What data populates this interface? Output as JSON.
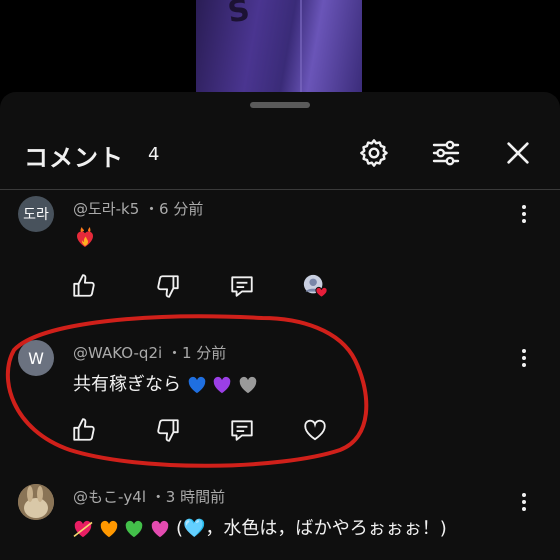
{
  "colors": {
    "sheet_bg": "#0f0f0f",
    "text_primary": "#f1f1f1",
    "text_secondary": "#aaaaaa",
    "annotation_red": "#d0201a",
    "like_heart": "#e61e3a"
  },
  "header": {
    "title": "コメント",
    "count": "4",
    "settings_icon": "gear-icon",
    "filter_icon": "sliders-icon",
    "close_icon": "close-icon"
  },
  "comments": [
    {
      "avatar_text": "도라",
      "avatar_color": "#48525c",
      "author": "@도라-k5",
      "time": "・6 分前",
      "text": "❤️‍🔥",
      "creator_heart": true
    },
    {
      "avatar_text": "W",
      "avatar_color": "#6b7280",
      "author": "@WAKO-q2i",
      "time": "・1 分前",
      "text_plain": "共有稼ぎなら",
      "emoji_hearts": [
        "#1f6fe0",
        "#9b3fe6",
        "#9a9a9a"
      ]
    },
    {
      "avatar_text": "",
      "avatar_color": "#b49a78",
      "author": "@もこ-y4l",
      "time": "・3 時間前",
      "text_plain": "(🩵，水色は，ばかやろぉぉぉ！)",
      "emoji_hearts": [
        "#e91e63",
        "#ff9800",
        "#43c04a",
        "#e34bb0"
      ]
    }
  ],
  "actions": {
    "like_icon": "thumbs-up-icon",
    "dislike_icon": "thumbs-down-icon",
    "reply_icon": "reply-icon",
    "heart_icon": "heart-icon",
    "more_icon": "more-vert-icon"
  }
}
